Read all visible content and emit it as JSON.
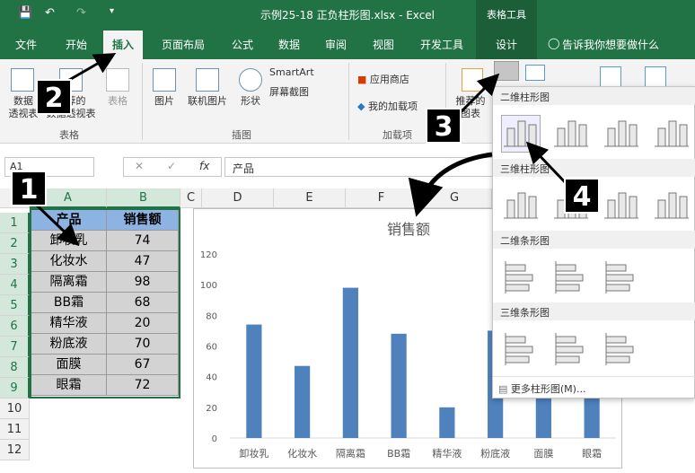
{
  "window": {
    "title": "示例25-18 正负柱形图.xlsx  -  Excel",
    "context_tools": "表格工具"
  },
  "tabs": [
    "文件",
    "开始",
    "插入",
    "页面布局",
    "公式",
    "数据",
    "审阅",
    "视图",
    "开发工具",
    "设计"
  ],
  "tellme": "告诉我你想要做什么",
  "ribbon": {
    "pivot": "数据\n透视表",
    "recommended_pivot": "推荐的\n数据透视表",
    "table": "表格",
    "group_table": "表格",
    "picture": "图片",
    "online_picture": "联机图片",
    "shapes": "形状",
    "smartart": "SmartArt",
    "screenshot": "屏幕截图",
    "group_illus": "插图",
    "store": "应用商店",
    "my_addins": "我的加载项",
    "group_addins": "加载项",
    "rec_charts": "推荐的\n图表"
  },
  "formula_bar": {
    "name_box": "A1",
    "fx": "fx",
    "value": "产品"
  },
  "columns": [
    "A",
    "B",
    "C",
    "D",
    "E",
    "F",
    "G"
  ],
  "rows": [
    "1",
    "2",
    "3",
    "4",
    "5",
    "6",
    "7",
    "8",
    "9",
    "10",
    "11",
    "12"
  ],
  "table": {
    "header": [
      "产品",
      "销售额"
    ],
    "rows": [
      [
        "卸妆乳",
        "74"
      ],
      [
        "化妆水",
        "47"
      ],
      [
        "隔离霜",
        "98"
      ],
      [
        "BB霜",
        "68"
      ],
      [
        "精华液",
        "20"
      ],
      [
        "粉底液",
        "70"
      ],
      [
        "面膜",
        "67"
      ],
      [
        "眼霜",
        "72"
      ]
    ]
  },
  "gallery": {
    "sec1": "二维柱形图",
    "sec2": "三维柱形图",
    "sec3": "二维条形图",
    "sec4": "三维条形图",
    "more": "更多柱形图(M)..."
  },
  "badges": [
    "1",
    "2",
    "3",
    "4"
  ],
  "chart_data": {
    "type": "bar",
    "title": "销售额",
    "categories": [
      "卸妆乳",
      "化妆水",
      "隔离霜",
      "BB霜",
      "精华液",
      "粉底液",
      "面膜",
      "眼霜"
    ],
    "values": [
      74,
      47,
      98,
      68,
      20,
      70,
      67,
      72
    ],
    "ylim": [
      0,
      120
    ],
    "yticks": [
      "0",
      "20",
      "40",
      "60",
      "80",
      "100",
      "120"
    ],
    "grid": false,
    "color": "#4f81bd"
  }
}
